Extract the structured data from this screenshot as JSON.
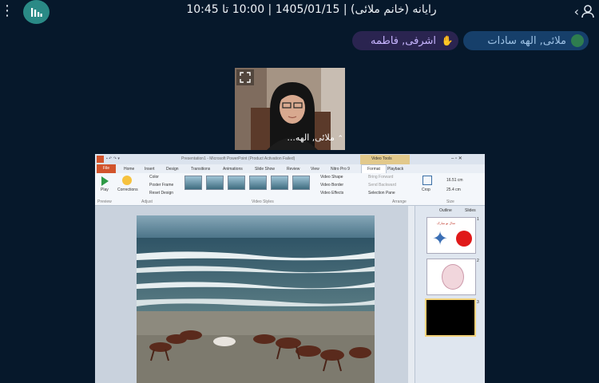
{
  "header": {
    "title": "رایانه (خانم ملائی) | 1405/01/15 | 10:00 تا 10:45"
  },
  "participants": [
    {
      "name": "ملائی, الهه سادات",
      "color": "#2e7d4f"
    },
    {
      "name": "اشرفی, فاطمه",
      "color": "#b85a2e"
    }
  ],
  "webcam": {
    "label": "ملائی, الهه..."
  },
  "ppt": {
    "window_title": "Presentation1 - Microsoft PowerPoint (Product Activation Failed)",
    "context_tab": "Video Tools",
    "tabs": [
      "File",
      "Home",
      "Insert",
      "Design",
      "Transitions",
      "Animations",
      "Slide Show",
      "Review",
      "View",
      "Nitro Pro 9",
      "Format",
      "Playback"
    ],
    "groups": {
      "preview": {
        "button": "Play",
        "name": "Preview"
      },
      "adjust": {
        "corrections": "Corrections",
        "color": "Color",
        "poster_frame": "Poster Frame",
        "reset_design": "Reset Design",
        "name": "Adjust"
      },
      "styles": {
        "name": "Video Styles",
        "shape": "Video Shape",
        "border": "Video Border",
        "effects": "Video Effects"
      },
      "arrange": {
        "bring_forward": "Bring Forward",
        "send_backward": "Send Backward",
        "selection_pane": "Selection Pane",
        "name": "Arrange"
      },
      "size": {
        "crop": "Crop",
        "height": "16.51 cm",
        "width": "25.4 cm",
        "name": "Size"
      }
    },
    "panel_tabs": [
      "Outline",
      "Slides"
    ],
    "slide_numbers": [
      "1",
      "2",
      "3"
    ],
    "thumb1_text": "سال نو مبارک"
  },
  "colors": {
    "background": "#06182b",
    "accent": "#2a8a86",
    "file_tab": "#d2542c",
    "context_tab": "#e7b53a"
  }
}
